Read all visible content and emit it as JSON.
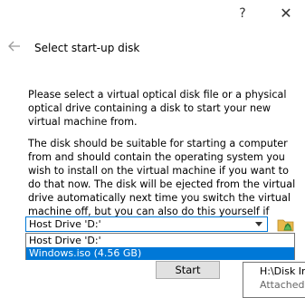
{
  "window": {
    "help_label": "?",
    "close_label": "✕"
  },
  "header": {
    "title": "Select start-up disk",
    "back_icon": "back-arrow-icon"
  },
  "body": {
    "paragraph1": "Please select a virtual optical disk file or a physical optical drive containing a disk to start your new virtual machine from.",
    "paragraph2": "The disk should be suitable for starting a computer from and should contain the operating system you wish to install on the virtual machine if you want to do that now. The disk will be ejected from the virtual drive automatically next time you switch the virtual machine off, but you can also do this yourself if needed using the Devices menu."
  },
  "combo": {
    "value": "Host Drive 'D:'",
    "options": [
      "Host Drive 'D:'",
      "Windows.iso (4.56 GB)"
    ],
    "highlighted_index": 1,
    "highlight_color": "#0078d7"
  },
  "buttons": {
    "start_label": "Start"
  },
  "tooltip": {
    "line1": "H:\\Disk Ima",
    "line2": "Attached to"
  }
}
